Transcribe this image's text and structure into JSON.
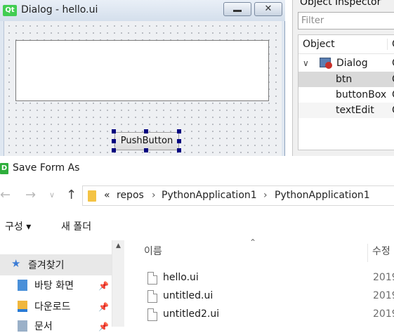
{
  "designer_dialog": {
    "title": "Dialog - hello.ui",
    "app_icon_text": "Qt",
    "pushbutton_label": "PushButton"
  },
  "object_inspector": {
    "title": "Object Inspector",
    "filter_placeholder": "Filter",
    "header_object": "Object",
    "header_class": "C",
    "rows": [
      {
        "name": "Dialog",
        "class": "C"
      },
      {
        "name": "btn",
        "class": "C"
      },
      {
        "name": "buttonBox",
        "class": "C"
      },
      {
        "name": "textEdit",
        "class": "C"
      }
    ]
  },
  "save_dialog": {
    "title": "Save Form As",
    "app_icon_text": "D",
    "breadcrumb": [
      "«",
      "repos",
      "PythonApplication1",
      "PythonApplication1"
    ],
    "toolbar": {
      "organize": "구성 ▾",
      "new_folder": "새 폴더"
    },
    "nav": {
      "quick_access": "즐겨찾기",
      "items": [
        "바탕 화면",
        "다운로드",
        "문서"
      ]
    },
    "columns": {
      "name": "이름",
      "date": "수정"
    },
    "files": [
      {
        "name": "hello.ui",
        "date": "2019"
      },
      {
        "name": "untitled.ui",
        "date": "2019"
      },
      {
        "name": "untitled2.ui",
        "date": "2019"
      }
    ]
  },
  "colors": {
    "selection_handle": "#000080",
    "qt_green": "#41cd52",
    "quick_access_bg": "#e8e8e8"
  }
}
